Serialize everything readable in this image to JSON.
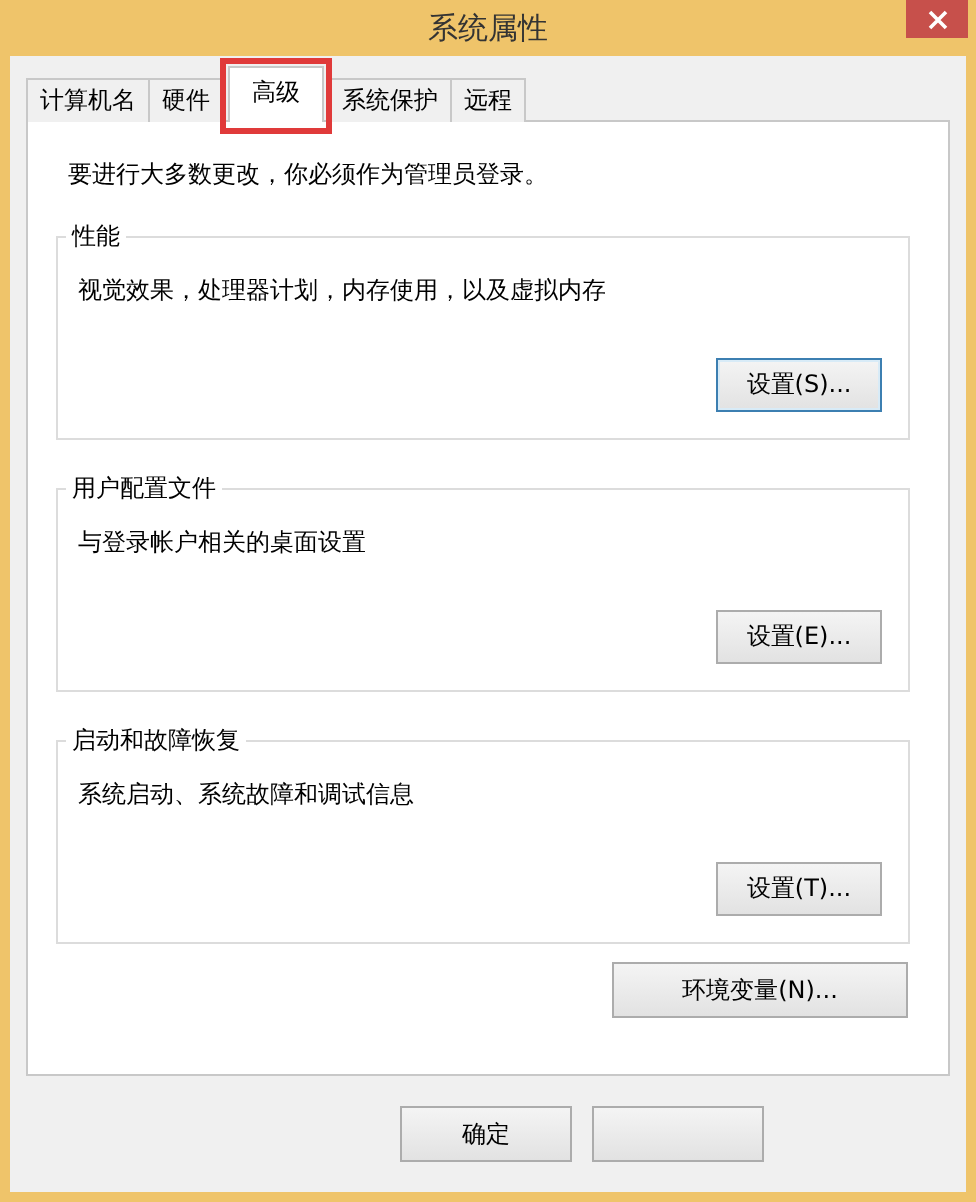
{
  "window": {
    "title": "系统属性"
  },
  "tabs": [
    {
      "label": "计算机名",
      "selected": false,
      "highlighted": false
    },
    {
      "label": "硬件",
      "selected": false,
      "highlighted": false
    },
    {
      "label": "高级",
      "selected": true,
      "highlighted": true
    },
    {
      "label": "系统保护",
      "selected": false,
      "highlighted": false
    },
    {
      "label": "远程",
      "selected": false,
      "highlighted": false
    }
  ],
  "notice": "要进行大多数更改，你必须作为管理员登录。",
  "groups": [
    {
      "title": "性能",
      "description": "视觉效果，处理器计划，内存使用，以及虚拟内存",
      "button": {
        "label": "设置(S)...",
        "focused": true
      }
    },
    {
      "title": "用户配置文件",
      "description": "与登录帐户相关的桌面设置",
      "button": {
        "label": "设置(E)...",
        "focused": false
      }
    },
    {
      "title": "启动和故障恢复",
      "description": "系统启动、系统故障和调试信息",
      "button": {
        "label": "设置(T)...",
        "focused": false
      }
    }
  ],
  "environment_button": "环境变量(N)...",
  "footer_buttons": [
    {
      "kind": "labeled",
      "label": "确定"
    },
    {
      "kind": "covered"
    }
  ]
}
